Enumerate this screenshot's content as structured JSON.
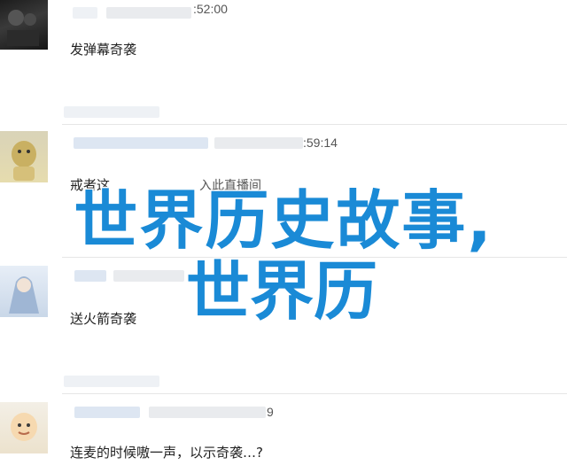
{
  "comments": [
    {
      "timestamp": ":52:00",
      "text": "发弹幕奇袭"
    },
    {
      "timestamp": ":59:14",
      "text": "戒者这",
      "reply": "入此直播间"
    },
    {
      "timestamp": "",
      "text": "送火箭奇袭"
    },
    {
      "timestamp": "9",
      "text": "连麦的时候嗷一声，以示奇袭…?"
    }
  ],
  "overlay": {
    "line1": "世界历史故事,",
    "line2": "世界历"
  }
}
